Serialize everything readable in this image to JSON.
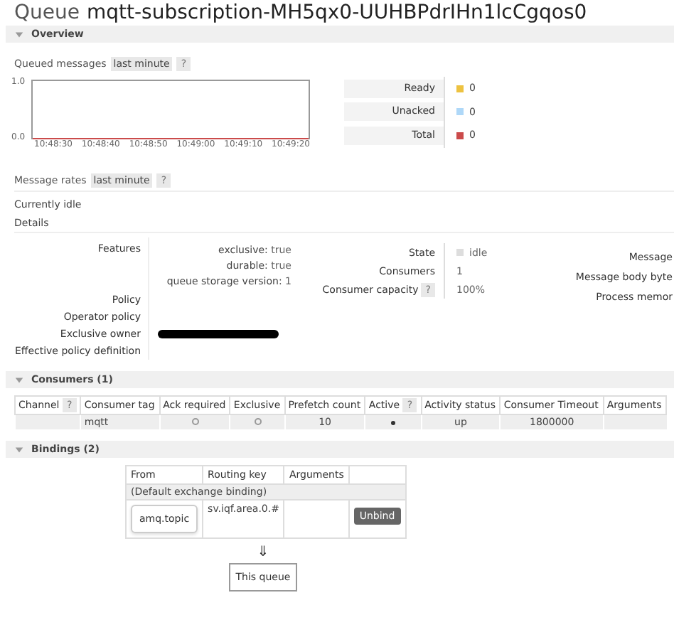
{
  "title": {
    "label": "Queue",
    "name": "mqtt-subscription-MH5qx0-UUHBPdrIHn1lcCgqos0"
  },
  "overview": {
    "heading": "Overview",
    "expanded": true
  },
  "queued_messages": {
    "label": "Queued messages",
    "range": "last minute",
    "help": "?",
    "chart": {
      "y_axis_labels": [
        "1.0",
        "0.0"
      ],
      "x_axis_labels": [
        "10:48:30",
        "10:48:40",
        "10:48:50",
        "10:49:00",
        "10:49:10",
        "10:49:20"
      ]
    },
    "legend": [
      {
        "label": "Ready",
        "color": "#edc240",
        "value": "0"
      },
      {
        "label": "Unacked",
        "color": "#afd8f8",
        "value": "0"
      },
      {
        "label": "Total",
        "color": "#cb4b4b",
        "value": "0"
      }
    ]
  },
  "message_rates": {
    "label": "Message rates",
    "range": "last minute",
    "help": "?"
  },
  "status": "Currently idle",
  "details": {
    "heading": "Details",
    "features_label": "Features",
    "features": [
      {
        "key": "exclusive:",
        "value": "true"
      },
      {
        "key": "durable:",
        "value": "true"
      },
      {
        "key": "queue storage version:",
        "value": "1"
      }
    ],
    "stats": [
      {
        "label": "State",
        "value": "idle",
        "kind": "state"
      },
      {
        "label": "Consumers",
        "value": "1",
        "kind": "plain"
      },
      {
        "label": "Consumer capacity",
        "help": "?",
        "value": "100%",
        "kind": "plain"
      }
    ],
    "right_labels": [
      "Message",
      "Message body byte",
      "Process memor"
    ],
    "policies": [
      {
        "label": "Policy",
        "redacted": false
      },
      {
        "label": "Operator policy",
        "redacted": false
      },
      {
        "label": "Exclusive owner",
        "redacted": true
      },
      {
        "label": "Effective policy definition",
        "redacted": false
      }
    ]
  },
  "consumers": {
    "heading": "Consumers (1)",
    "expanded": true,
    "columns": [
      {
        "label": "Channel",
        "help": "?"
      },
      {
        "label": "Consumer tag"
      },
      {
        "label": "Ack required"
      },
      {
        "label": "Exclusive"
      },
      {
        "label": "Prefetch count"
      },
      {
        "label": "Active",
        "help": "?"
      },
      {
        "label": "Activity status"
      },
      {
        "label": "Consumer Timeout"
      },
      {
        "label": "Arguments"
      }
    ],
    "rows": [
      {
        "consumer_tag": "mqtt",
        "ack_required": false,
        "exclusive": false,
        "prefetch_count": "10",
        "active": true,
        "activity_status": "up",
        "consumer_timeout": "1800000"
      }
    ]
  },
  "bindings": {
    "heading": "Bindings (2)",
    "expanded": true,
    "columns": [
      "From",
      "Routing key",
      "Arguments"
    ],
    "default_binding": "(Default exchange binding)",
    "rows": [
      {
        "from": "amq.topic",
        "routing_key": "sv.iqf.area.0.#",
        "action": "Unbind"
      }
    ],
    "arrow": "⇓",
    "target": "This queue"
  }
}
